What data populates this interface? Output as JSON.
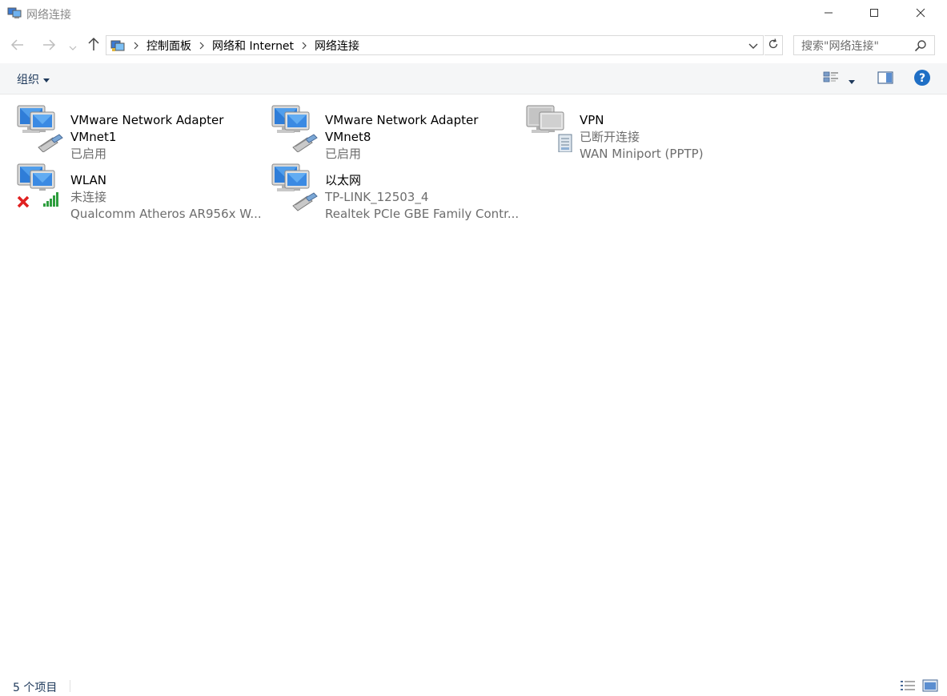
{
  "window": {
    "title": "网络连接"
  },
  "navigation": {
    "breadcrumbs": [
      "控制面板",
      "网络和 Internet",
      "网络连接"
    ],
    "search_placeholder": "搜索\"网络连接\""
  },
  "toolbar": {
    "organize_label": "组织"
  },
  "connections": [
    {
      "name": "VMware Network Adapter",
      "status": "VMnet1",
      "device": "已启用",
      "icon": "network-adapter-icon"
    },
    {
      "name": "VMware Network Adapter",
      "status": "VMnet8",
      "device": "已启用",
      "icon": "network-adapter-icon"
    },
    {
      "name": "VPN",
      "status": "已断开连接",
      "device": "WAN Miniport (PPTP)",
      "icon": "vpn-icon"
    },
    {
      "name": "WLAN",
      "status": "未连接",
      "device": "Qualcomm Atheros AR956x W...",
      "icon": "wireless-icon"
    },
    {
      "name": "以太网",
      "status": "TP-LINK_12503_4",
      "device": "Realtek PCIe GBE Family Contr...",
      "icon": "ethernet-icon"
    }
  ],
  "statusbar": {
    "item_count": "5 个项目"
  },
  "colors": {
    "accent": "#0078d7",
    "help": "#1f6fc5",
    "toolbar_bg": "#f5f6f7",
    "secondary_text": "#6d6d6d"
  }
}
